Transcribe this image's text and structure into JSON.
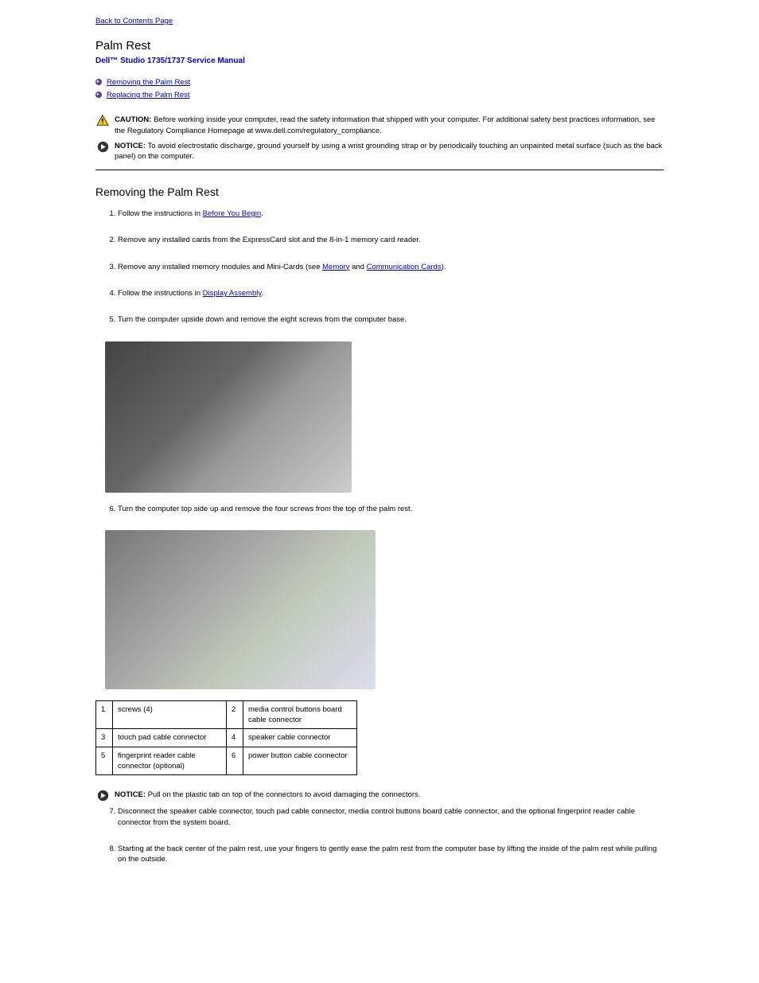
{
  "back_link": "Back to Contents Page",
  "section_title": "Palm Rest",
  "manual_title": "Dell™ Studio 1735/1737 Service Manual",
  "toc": {
    "items": [
      {
        "label": "Removing the Palm Rest"
      },
      {
        "label": "Replacing the Palm Rest"
      }
    ]
  },
  "caution": {
    "label": "CAUTION:",
    "text": " Before working inside your computer, read the safety information that shipped with your computer. For additional safety best practices information, see the Regulatory Compliance Homepage at www.dell.com/regulatory_compliance."
  },
  "notice1": {
    "label": "NOTICE:",
    "text": " To avoid electrostatic discharge, ground yourself by using a wrist grounding strap or by periodically touching an unpainted metal surface (such as the back panel) on the computer."
  },
  "subsection_title": "Removing the Palm Rest",
  "steps": [
    {
      "pre": "Follow the instructions in ",
      "link": "Before You Begin",
      "post": "."
    },
    {
      "pre": "Remove any installed cards from the ExpressCard slot and the 8-in-1 memory card reader.",
      "link": "",
      "post": ""
    },
    {
      "pre": "Remove any installed memory modules and Mini-Cards (see ",
      "link": "Memory",
      "post": " and ",
      "link2": "Communication Cards",
      "post2": ")."
    },
    {
      "pre": "Follow the instructions in ",
      "link": "Display Assembly",
      "post": "."
    },
    {
      "pre": "Turn the computer upside down and remove the eight screws from the computer base.",
      "link": "",
      "post": ""
    }
  ],
  "step6": "Turn the computer top side up and remove the four screws from the top of the palm rest.",
  "legend": {
    "rows": [
      {
        "n1": "1",
        "d1": "screws (4)",
        "n2": "2",
        "d2": "media control buttons board cable connector"
      },
      {
        "n1": "3",
        "d1": "touch pad cable connector",
        "n2": "4",
        "d2": "speaker cable connector"
      },
      {
        "n1": "5",
        "d1": "fingerprint reader cable connector (optional)",
        "n2": "6",
        "d2": "power button cable connector"
      }
    ]
  },
  "notice2": {
    "label": "NOTICE:",
    "text": " Pull on the plastic tab on top of the connectors to avoid damaging the connectors."
  },
  "step7": "Disconnect the speaker cable connector, touch pad cable connector, media control buttons board cable connector, and the optional fingerprint reader cable connector from the system board.",
  "step8": "Starting at the back center of the palm rest, use your fingers to gently ease the palm rest from the computer base by lifting the inside of the palm rest while pulling on the outside."
}
